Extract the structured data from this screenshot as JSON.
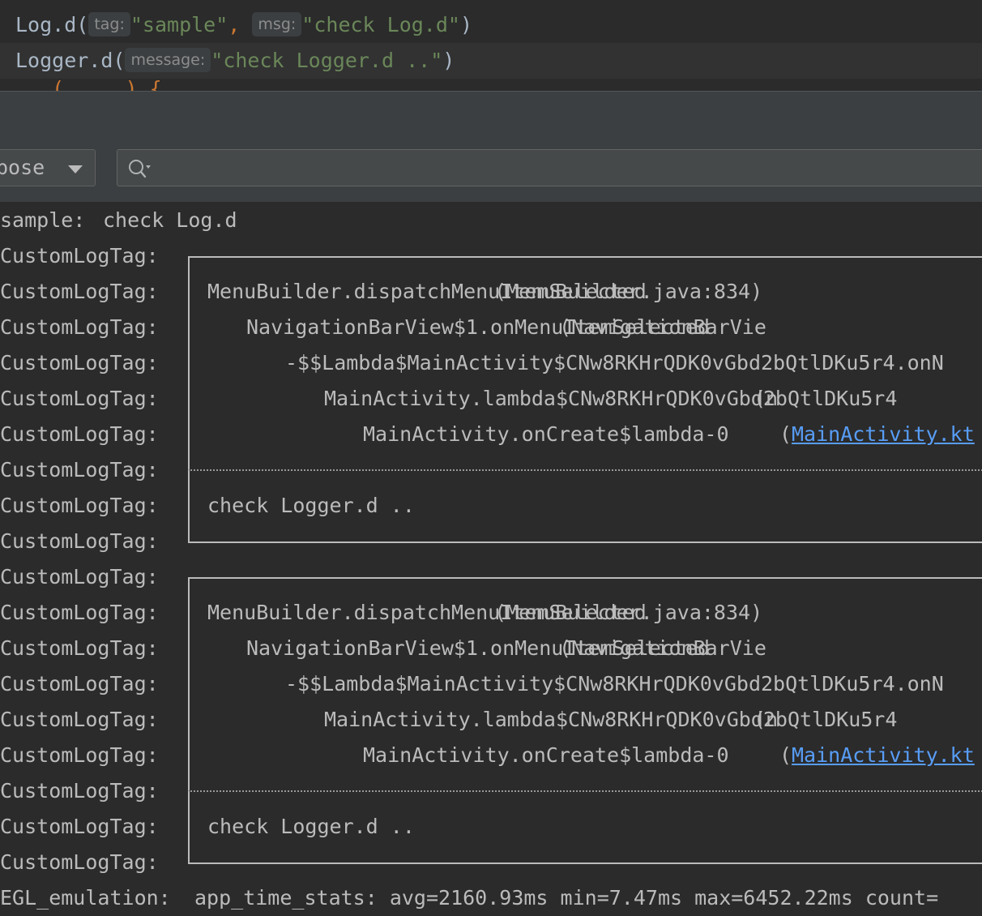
{
  "editor": {
    "line1": {
      "call": "Log.d(",
      "hint_tag": "tag:",
      "arg_tag": "\"sample\"",
      "comma": ",",
      "hint_msg": "msg:",
      "arg_msg": "\"check Log.d\"",
      "close": ")"
    },
    "line2": {
      "call": "Logger.d(",
      "hint_message": "message:",
      "arg_message": "\"check Logger.d ..\"",
      "close": ")"
    },
    "line3_partial": "  ...(  ...  ) {"
  },
  "toolbar": {
    "process_dropdown_label": "pose",
    "search_placeholder": ""
  },
  "log": {
    "first": {
      "tag": "sample:",
      "message": "check Log.d"
    },
    "custom_tag": "CustomLogTag:",
    "blocks": [
      {
        "stack": [
          {
            "method": "MenuBuilder.dispatchMenuItemSelected",
            "location": "(MenuBuilder.java:834)",
            "is_link": false
          },
          {
            "method": "NavigationBarView$1.onMenuItemSelected",
            "location": "(NavigationBarVie",
            "is_link": false
          },
          {
            "method": "-$$Lambda$MainActivity$CNw8RKHrQDK0vGbd2bQtlDKu5r4.onN",
            "location": "",
            "is_link": false
          },
          {
            "method": "MainActivity.lambda$CNw8RKHrQDK0vGbd2bQtlDKu5r4",
            "location": "(n",
            "is_link": false
          },
          {
            "method": "MainActivity.onCreate$lambda-0",
            "location_prefix": "(",
            "location": "MainActivity.kt",
            "is_link": true
          }
        ],
        "message": "check Logger.d .."
      },
      {
        "stack": [
          {
            "method": "MenuBuilder.dispatchMenuItemSelected",
            "location": "(MenuBuilder.java:834)",
            "is_link": false
          },
          {
            "method": "NavigationBarView$1.onMenuItemSelected",
            "location": "(NavigationBarVie",
            "is_link": false
          },
          {
            "method": "-$$Lambda$MainActivity$CNw8RKHrQDK0vGbd2bQtlDKu5r4.onN",
            "location": "",
            "is_link": false
          },
          {
            "method": "MainActivity.lambda$CNw8RKHrQDK0vGbd2bQtlDKu5r4",
            "location": "(n",
            "is_link": false
          },
          {
            "method": "MainActivity.onCreate$lambda-0",
            "location_prefix": "(",
            "location": "MainActivity.kt",
            "is_link": true
          }
        ],
        "message": "check Logger.d .."
      }
    ],
    "last": {
      "tag": "EGL_emulation:",
      "message": "app_time_stats: avg=2160.93ms min=7.47ms max=6452.22ms count="
    }
  },
  "colors": {
    "background": "#2b2b2b",
    "panel": "#3c3f41",
    "log_text": "#bbbbbb",
    "string": "#6a8759",
    "keyword": "#cc7832",
    "link": "#589df6"
  },
  "icons": [
    "search-icon",
    "dropdown-arrow-icon"
  ]
}
